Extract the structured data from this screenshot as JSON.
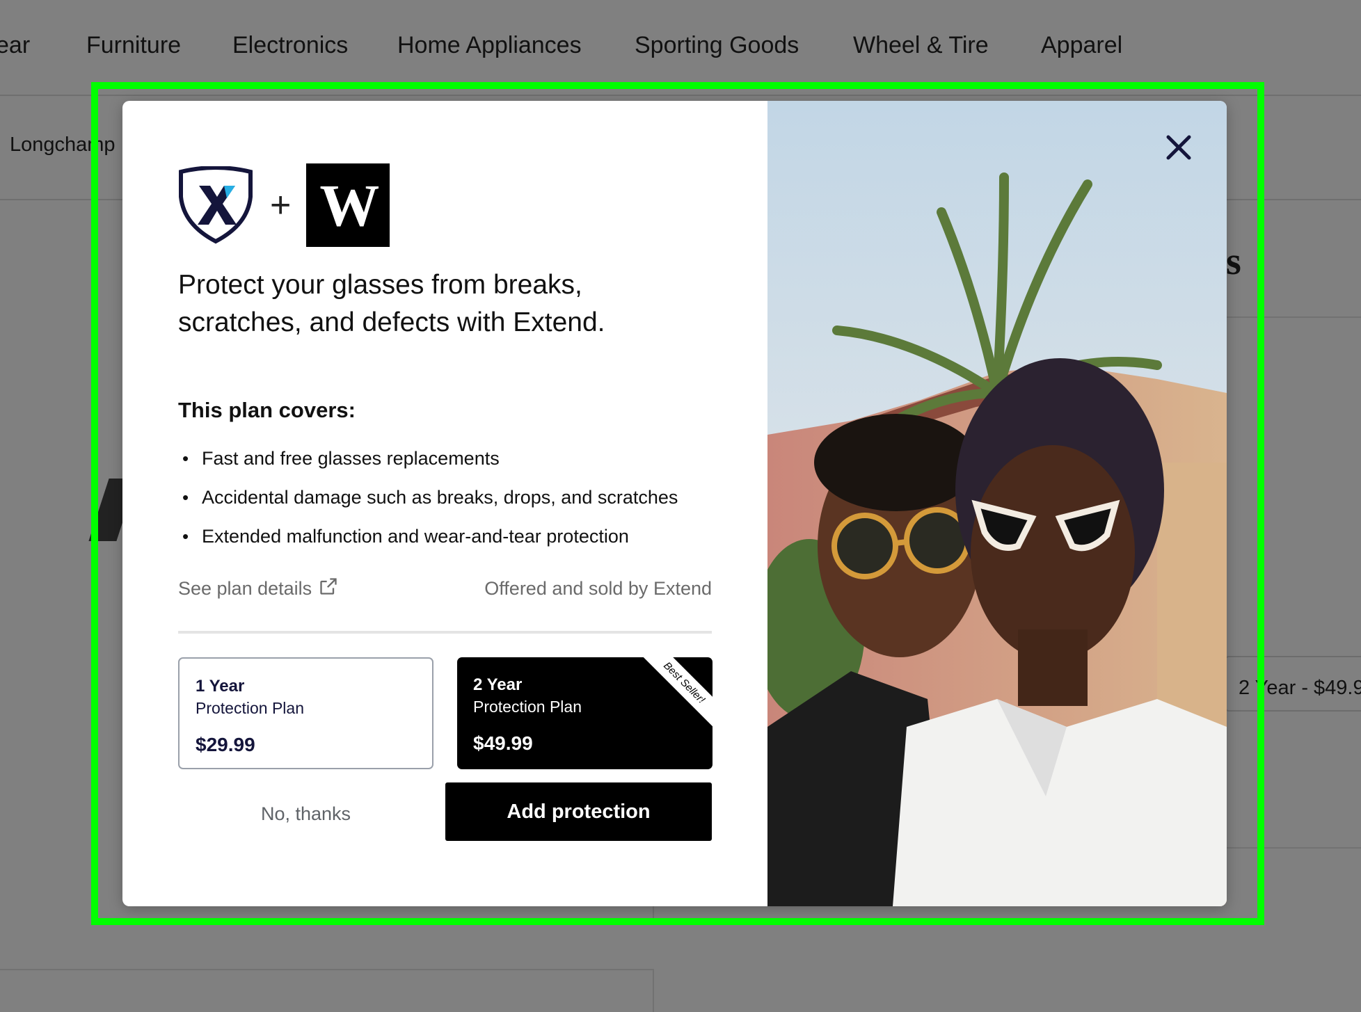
{
  "nav": {
    "items": [
      "ear",
      "Furniture",
      "Electronics",
      "Home Appliances",
      "Sporting Goods",
      "Wheel & Tire",
      "Apparel"
    ]
  },
  "background": {
    "brand_crumb": "Longchamp",
    "plan_pill": "2 Year - $49.9",
    "heading_glyph": "s"
  },
  "modal": {
    "headline": "Protect your glasses from breaks, scratches, and defects with Extend.",
    "logo_plus": "+",
    "partner_logo_letter": "W",
    "covers_title": "This plan covers:",
    "covers": [
      "Fast and free glasses replacements",
      "Accidental damage such as breaks, drops, and scratches",
      "Extended malfunction and wear-and-tear protection"
    ],
    "see_plan_details": "See plan details",
    "offered_by": "Offered and sold by Extend",
    "plans": [
      {
        "years": "1 Year",
        "label": "Protection Plan",
        "price": "$29.99",
        "selected": false
      },
      {
        "years": "2 Year",
        "label": "Protection Plan",
        "price": "$49.99",
        "selected": true,
        "ribbon": "Best Seller!"
      }
    ],
    "decline_label": "No, thanks",
    "accept_label": "Add protection"
  },
  "colors": {
    "overlay": "#808080",
    "highlight": "#00ff00",
    "accent": "#000000",
    "plan_text": "#14153b",
    "muted_text": "#6a6a6a"
  },
  "icons": [
    "extend-shield-icon",
    "external-link-icon",
    "close-icon"
  ]
}
